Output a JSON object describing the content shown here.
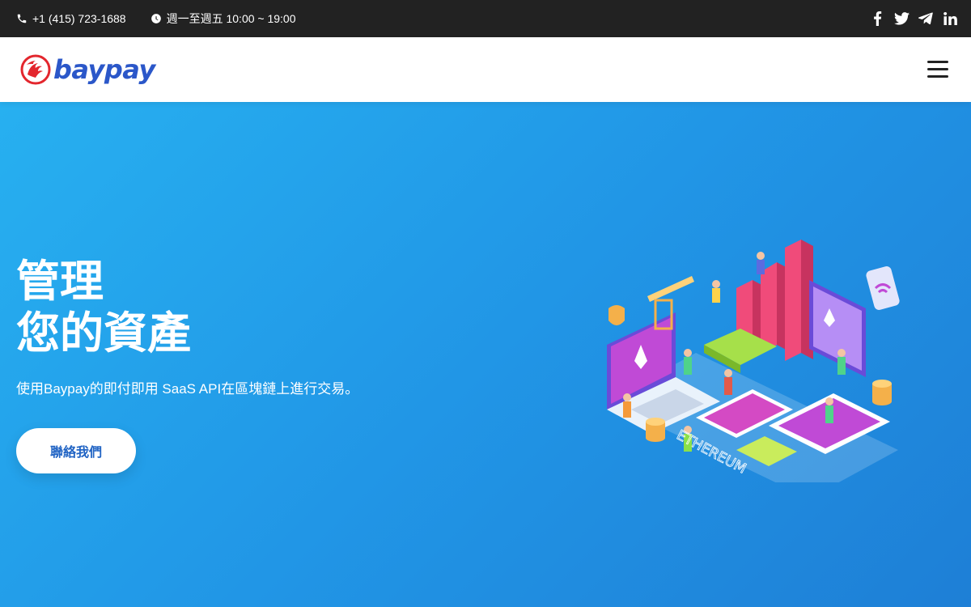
{
  "topbar": {
    "phone": "+1 (415) 723-1688",
    "hours": "週一至週五 10:00 ~ 19:00",
    "social": [
      "facebook-icon",
      "twitter-icon",
      "telegram-icon",
      "linkedin-icon"
    ]
  },
  "navbar": {
    "brand": "baypay",
    "menu_icon": "hamburger-menu-icon"
  },
  "hero": {
    "title_line1": "管理",
    "title_line2": "您的資產",
    "subtitle": "使用Baypay的即付即用 SaaS API在區塊鏈上進行交易。",
    "cta_label": "聯絡我們",
    "illustration_text": "ETHEREUM"
  },
  "colors": {
    "topbar_bg": "#222222",
    "brand_blue": "#2b57c9",
    "brand_red": "#e3262d",
    "hero_gradient_start": "#27b0f0",
    "hero_gradient_end": "#1e7fd6",
    "cta_text": "#2164c4"
  }
}
